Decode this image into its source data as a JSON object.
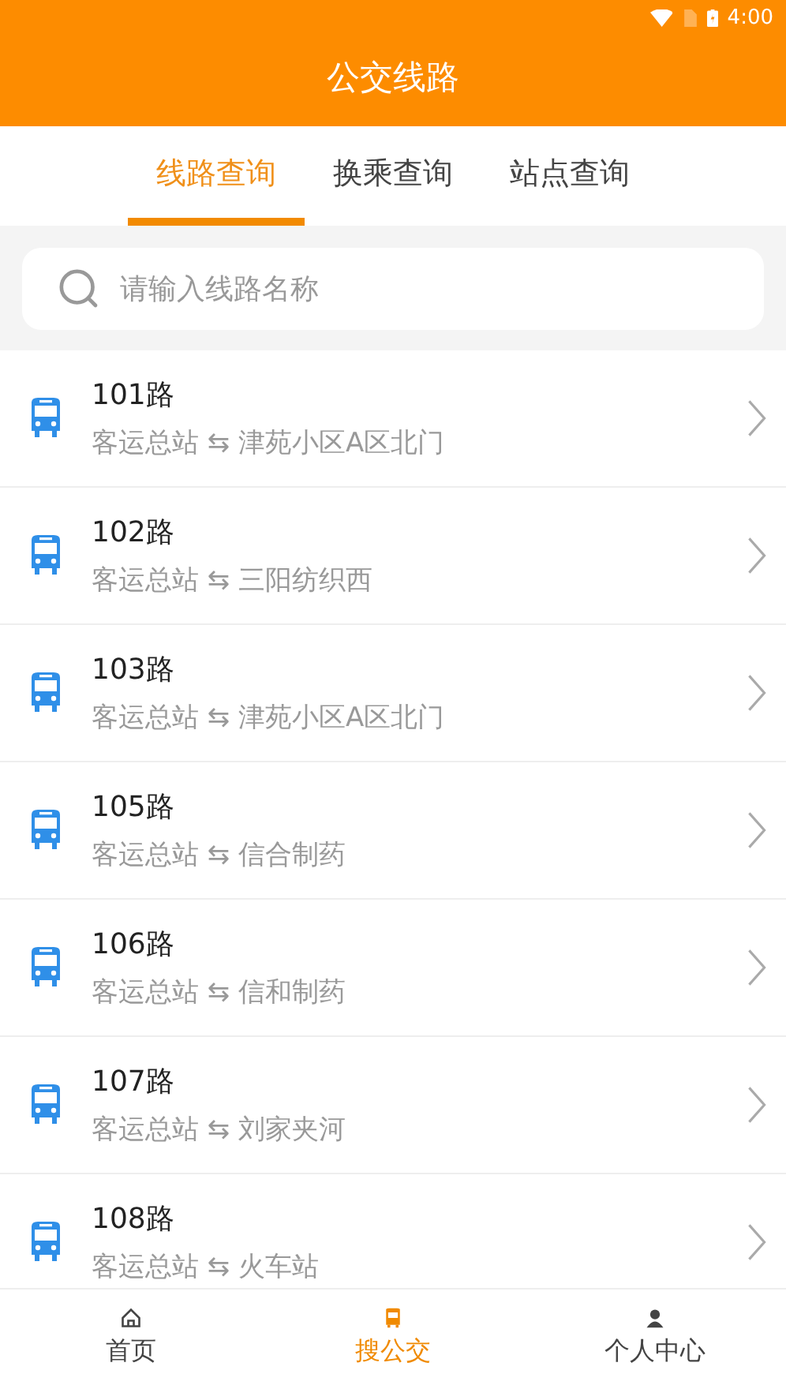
{
  "status_bar": {
    "time": "4:00"
  },
  "header": {
    "title": "公交线路"
  },
  "tabs": [
    {
      "label": "线路查询",
      "selected": true
    },
    {
      "label": "换乘查询",
      "selected": false
    },
    {
      "label": "站点查询",
      "selected": false
    }
  ],
  "search": {
    "placeholder": "请输入线路名称"
  },
  "routes": [
    {
      "name": "101路",
      "stops": "客运总站 ⇆ 津苑小区A区北门"
    },
    {
      "name": "102路",
      "stops": "客运总站 ⇆ 三阳纺织西"
    },
    {
      "name": "103路",
      "stops": "客运总站 ⇆ 津苑小区A区北门"
    },
    {
      "name": "105路",
      "stops": "客运总站 ⇆ 信合制药"
    },
    {
      "name": "106路",
      "stops": "客运总站 ⇆ 信和制药"
    },
    {
      "name": "107路",
      "stops": "客运总站 ⇆ 刘家夹河"
    },
    {
      "name": "108路",
      "stops": "客运总站 ⇆ 火车站"
    }
  ],
  "bottom_nav": [
    {
      "label": "首页",
      "kind": "home",
      "selected": false
    },
    {
      "label": "搜公交",
      "kind": "bus",
      "selected": true
    },
    {
      "label": "个人中心",
      "kind": "person",
      "selected": false
    }
  ]
}
